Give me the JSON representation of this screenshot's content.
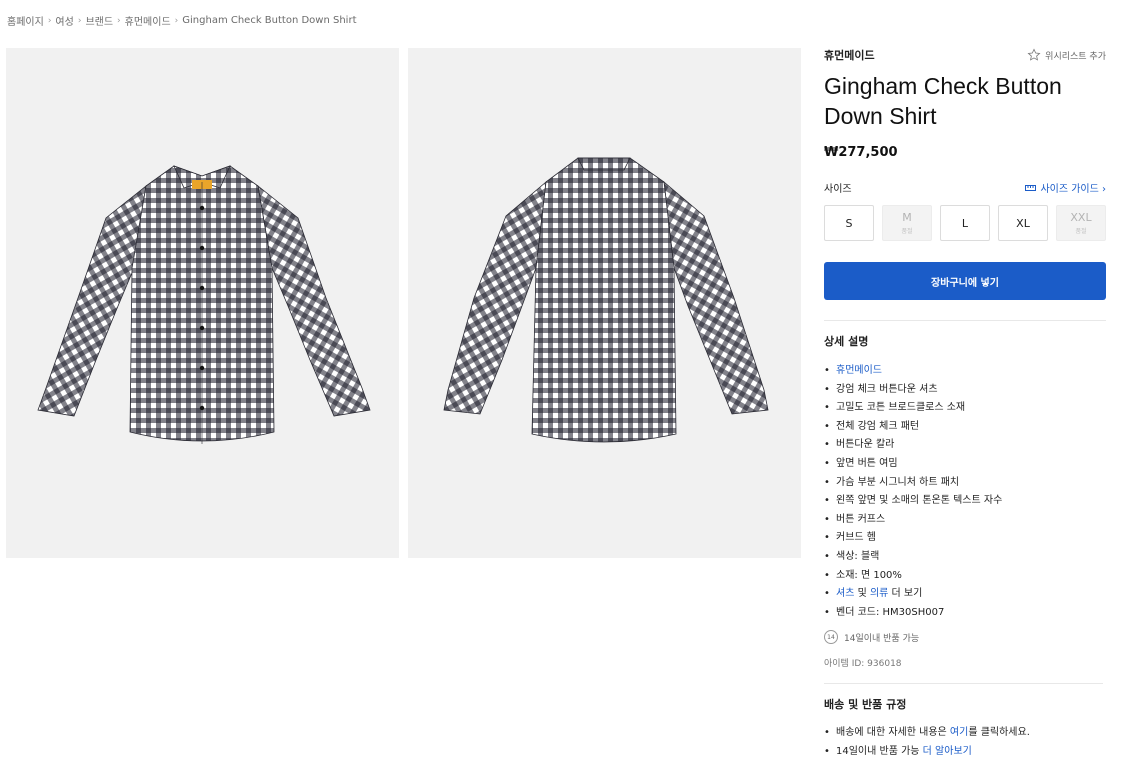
{
  "breadcrumb": [
    {
      "label": "홈페이지"
    },
    {
      "label": "여성"
    },
    {
      "label": "브랜드"
    },
    {
      "label": "휴먼메이드"
    },
    {
      "label": "Gingham Check Button Down Shirt"
    }
  ],
  "breadcrumb_separator": "›",
  "product": {
    "brand": "휴먼메이드",
    "wishlist_label": "위시리스트 추가",
    "title": "Gingham Check Button Down Shirt",
    "price": "₩277,500"
  },
  "sizes": {
    "label": "사이즈",
    "guide_label": "사이즈 가이드 ›",
    "options": [
      {
        "label": "S",
        "available": true,
        "note": ""
      },
      {
        "label": "M",
        "available": false,
        "note": "품절"
      },
      {
        "label": "L",
        "available": true,
        "note": ""
      },
      {
        "label": "XL",
        "available": true,
        "note": ""
      },
      {
        "label": "XXL",
        "available": false,
        "note": "품절"
      }
    ]
  },
  "cart_button": "장바구니에 넣기",
  "details": {
    "title": "상세 설명",
    "brand_link": "휴먼메이드",
    "items": [
      "강엄 체크 버튼다운 셔츠",
      "고밀도 코튼 브로드클로스 소재",
      "전체 강엄 체크 패턴",
      "버튼다운 칼라",
      "앞면 버튼 여밈",
      "가슴 부분 시그니처 하트 패치",
      "왼쪽 앞면 및 소매의 톤온톤 텍스트 자수",
      "버튼 커프스",
      "커브드 헴",
      "색상: 블랙",
      "소재: 면 100%"
    ],
    "more_link_1": "셔츠",
    "more_and": " 및 ",
    "more_link_2": "의류",
    "more_suffix": " 더 보기",
    "vendor_code": "벤더 코드: HM30SH007"
  },
  "returns": {
    "badge": "14",
    "text": "14일이내 반품 가능"
  },
  "item_id": "아이템 ID: 936018",
  "shipping": {
    "title": "배송 및 반품 규정",
    "line1_prefix": "배송에 대한 자세한 내용은 ",
    "line1_link": "여기",
    "line1_suffix": "를 클릭하세요.",
    "line2_prefix": "14일이내 반품 가능 ",
    "line2_link": "더 알아보기"
  },
  "images": [
    {
      "icon": "shirt-front-image"
    },
    {
      "icon": "shirt-back-image"
    }
  ],
  "colors": {
    "accent": "#1b5cc8",
    "image_bg": "#f1f1f1",
    "gingham_dark": "#1c1c2a"
  }
}
